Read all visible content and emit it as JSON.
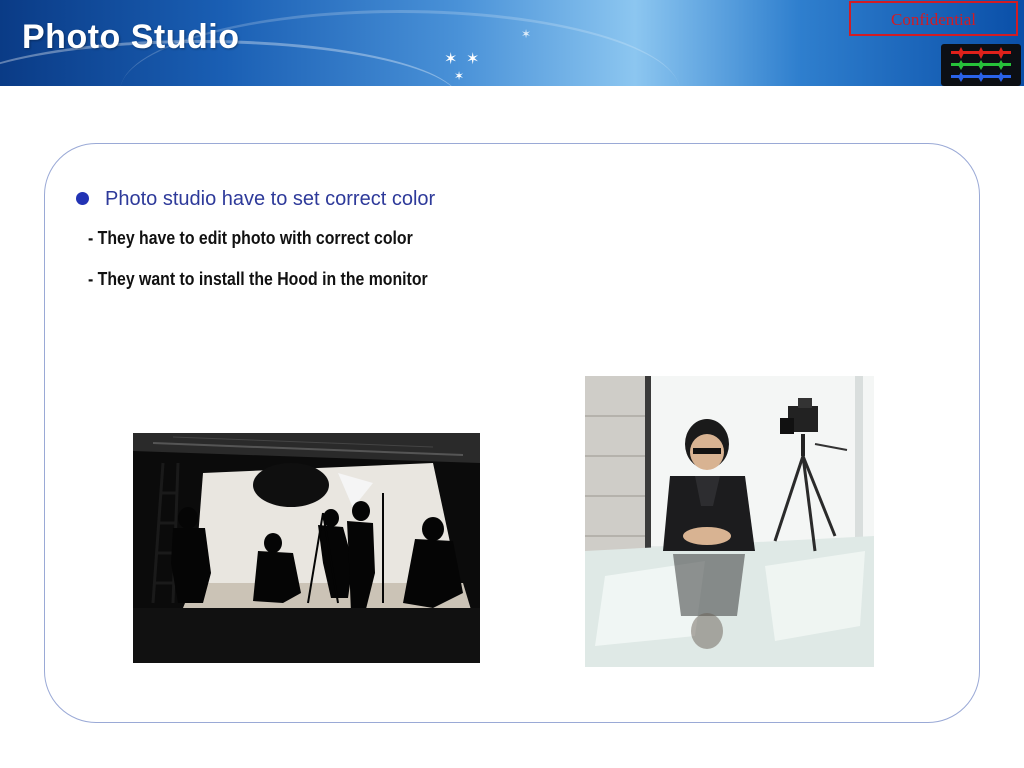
{
  "header": {
    "title": "Photo Studio",
    "confidential_label": "Confidential"
  },
  "content": {
    "bullet": "Photo studio have to set correct color",
    "sub_points": [
      "- They have to edit photo with correct color",
      "- They want to install the Hood in the monitor"
    ]
  },
  "images": {
    "studio_photo": "photo studio scene with silhouetted photographers and lights",
    "photographer_photo": "photographer posing next to camera on tripod"
  },
  "colors": {
    "header_dark": "#0a3b86",
    "header_light": "#8cc6f0",
    "confidential_red": "#d21c24",
    "bullet_blue": "#2233b4",
    "bullet_text": "#2e3a9a",
    "box_border": "#9aa9d6"
  }
}
